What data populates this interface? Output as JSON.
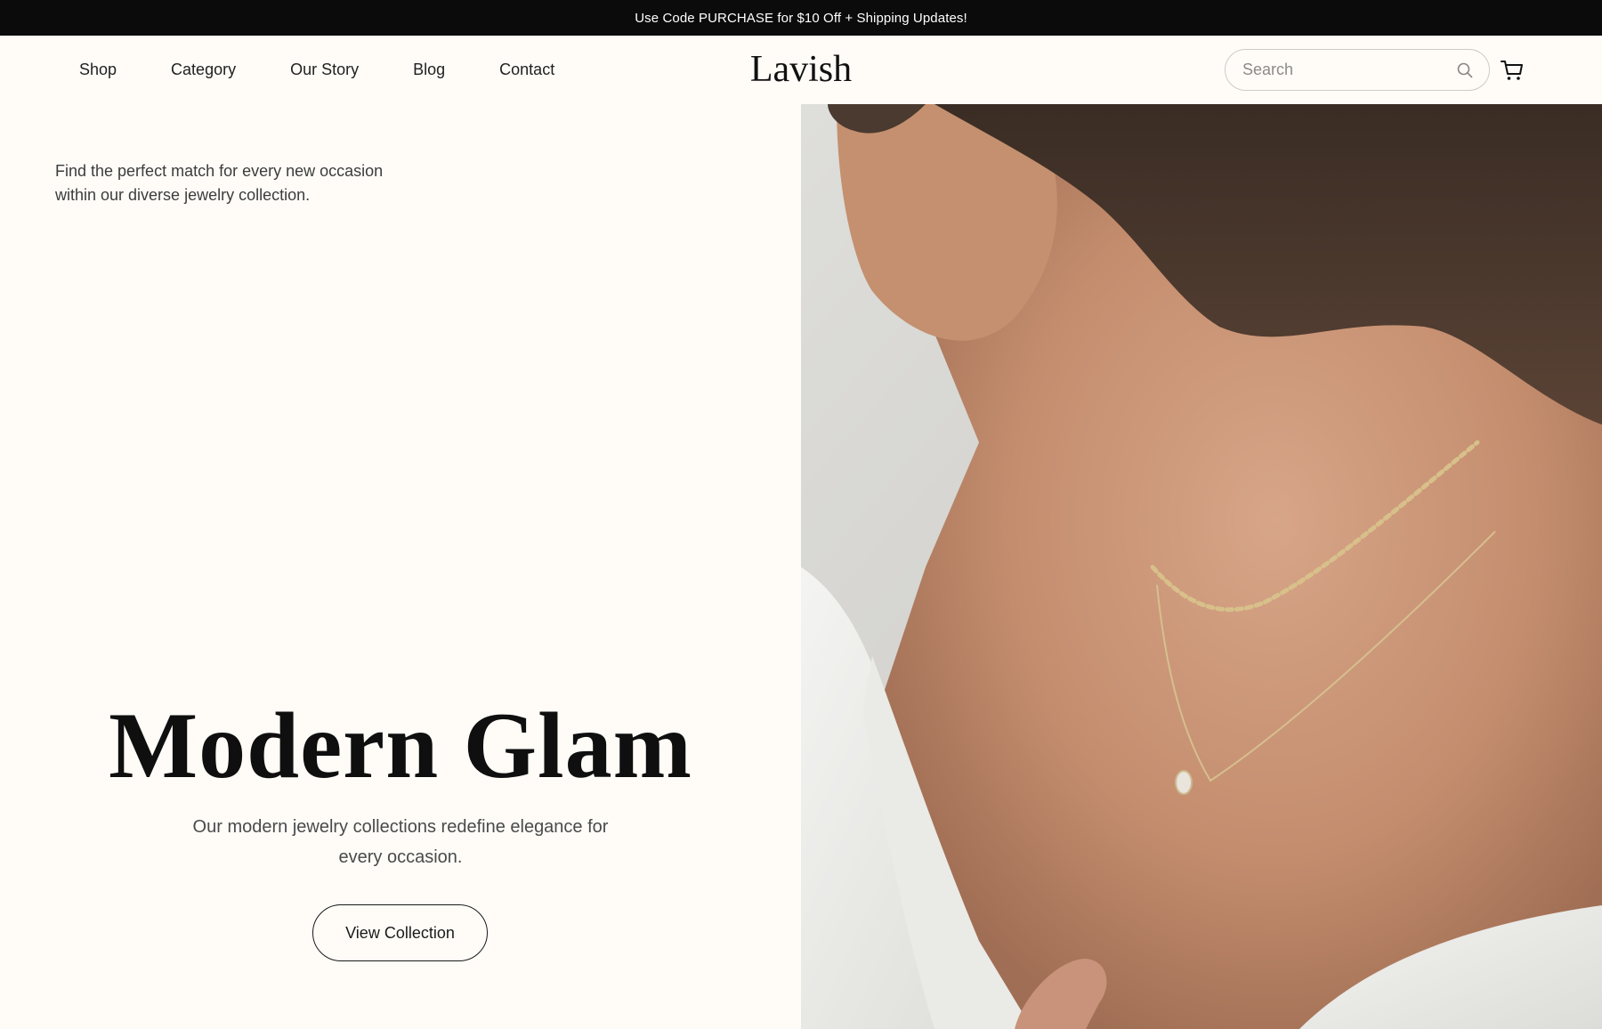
{
  "promo": {
    "text": "Use Code PURCHASE for $10 Off + Shipping Updates!"
  },
  "nav": {
    "items": [
      {
        "label": "Shop"
      },
      {
        "label": "Category"
      },
      {
        "label": "Our Story"
      },
      {
        "label": "Blog"
      },
      {
        "label": "Contact"
      }
    ]
  },
  "brand": {
    "logo": "Lavish"
  },
  "search": {
    "placeholder": "Search",
    "value": "",
    "icon": "search-icon"
  },
  "cart": {
    "icon": "cart-icon"
  },
  "hero": {
    "intro": "Find the perfect match for every new occasion within our diverse jewelry collection.",
    "title": "Modern Glam",
    "subtitle": "Our modern jewelry collections redefine elegance for every occasion.",
    "cta_label": "View Collection"
  },
  "colors": {
    "background": "#fffcf8",
    "promo_bar": "#0b0b0b",
    "text": "#111111"
  }
}
